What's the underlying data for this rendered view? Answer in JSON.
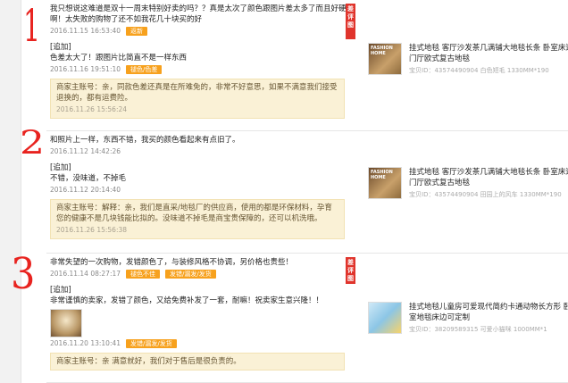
{
  "left_numbers": [
    "1",
    "2",
    "3"
  ],
  "reviews": [
    {
      "badge": "差评图",
      "text": "我只想说这难道是双十一周末特别好卖的吗？？真是太次了颜色跟图片差太多了而且好硬啊！太失败的购物了还不如我花几十块买的好",
      "date": "2016.11.15 16:53:40",
      "tags": [
        "返新"
      ],
      "append_label": "[追加]",
      "append_text": "色差太大了！跟图片比简直不是一样东西",
      "append_date": "2016.11.16 19:51:10",
      "append_tags": [
        "褪色/色差"
      ],
      "reply_text": "商家主账号：亲，同款色差还真是在所难免的，非常不好意思，如果不满意我们接受退换的，都有运费险。",
      "reply_date": "2016.11.26 15:56:24",
      "product": {
        "title": "挂式地毯 客厅沙发茶几满铺大地毯长条 卧室床边门厅欧式复古地毯",
        "sku": "宝贝ID：43574490904 白色短毛 1330MM*190",
        "image_logo": "FASHION HOME"
      }
    },
    {
      "text": "和照片上一样，东西不错，我买的颜色看起来有点旧了。",
      "date": "2016.11.12 14:42:26",
      "append_label": "[追加]",
      "append_text": "不错，没味道，不掉毛",
      "append_date": "2016.11.12 20:14:40",
      "reply_text": "商家主账号：解释：亲，我们是直采/地毯厂的供应商，使用的都是环保材料，孕育您的健康不是几块钱能比拟的。没味道不掉毛是商宝贵保障的，还可以机洗哦。",
      "reply_date": "2016.11.26 15:56:38",
      "product": {
        "title": "挂式地毯 客厅沙发茶几满铺大地毯长条 卧室床边门厅欧式复古地毯",
        "sku": "宝贝ID：43574490904 田园上的风车 1330MM*190",
        "image_logo": "FASHION HOME"
      }
    },
    {
      "badge": "差评图",
      "text": "非常失望的一次购物，发错颜色了，与装修风格不协调，另价格也贵些！",
      "date": "2016.11.14 08:27:17",
      "tags": [
        "褪色不佳",
        "发错/漏发/发货"
      ],
      "append_label": "[追加]",
      "append_text": "非常谨慎的卖家，发错了颜色，又给免费补发了一套，耐嘛！祝卖家生意兴隆！！",
      "append_date": "2016.11.20 13:10:41",
      "append_tags": [
        "发错/漏发/发货"
      ],
      "reply_text": "商家主账号：亲 满意就好，我们对于售后是很负责的。",
      "product": {
        "title": "挂式地毯儿童房可爱现代简约卡通动物长方形 卧室地毯床边可定制",
        "sku": "宝贝ID：38209589315 可爱小猫咪 1000MM*1"
      }
    }
  ]
}
